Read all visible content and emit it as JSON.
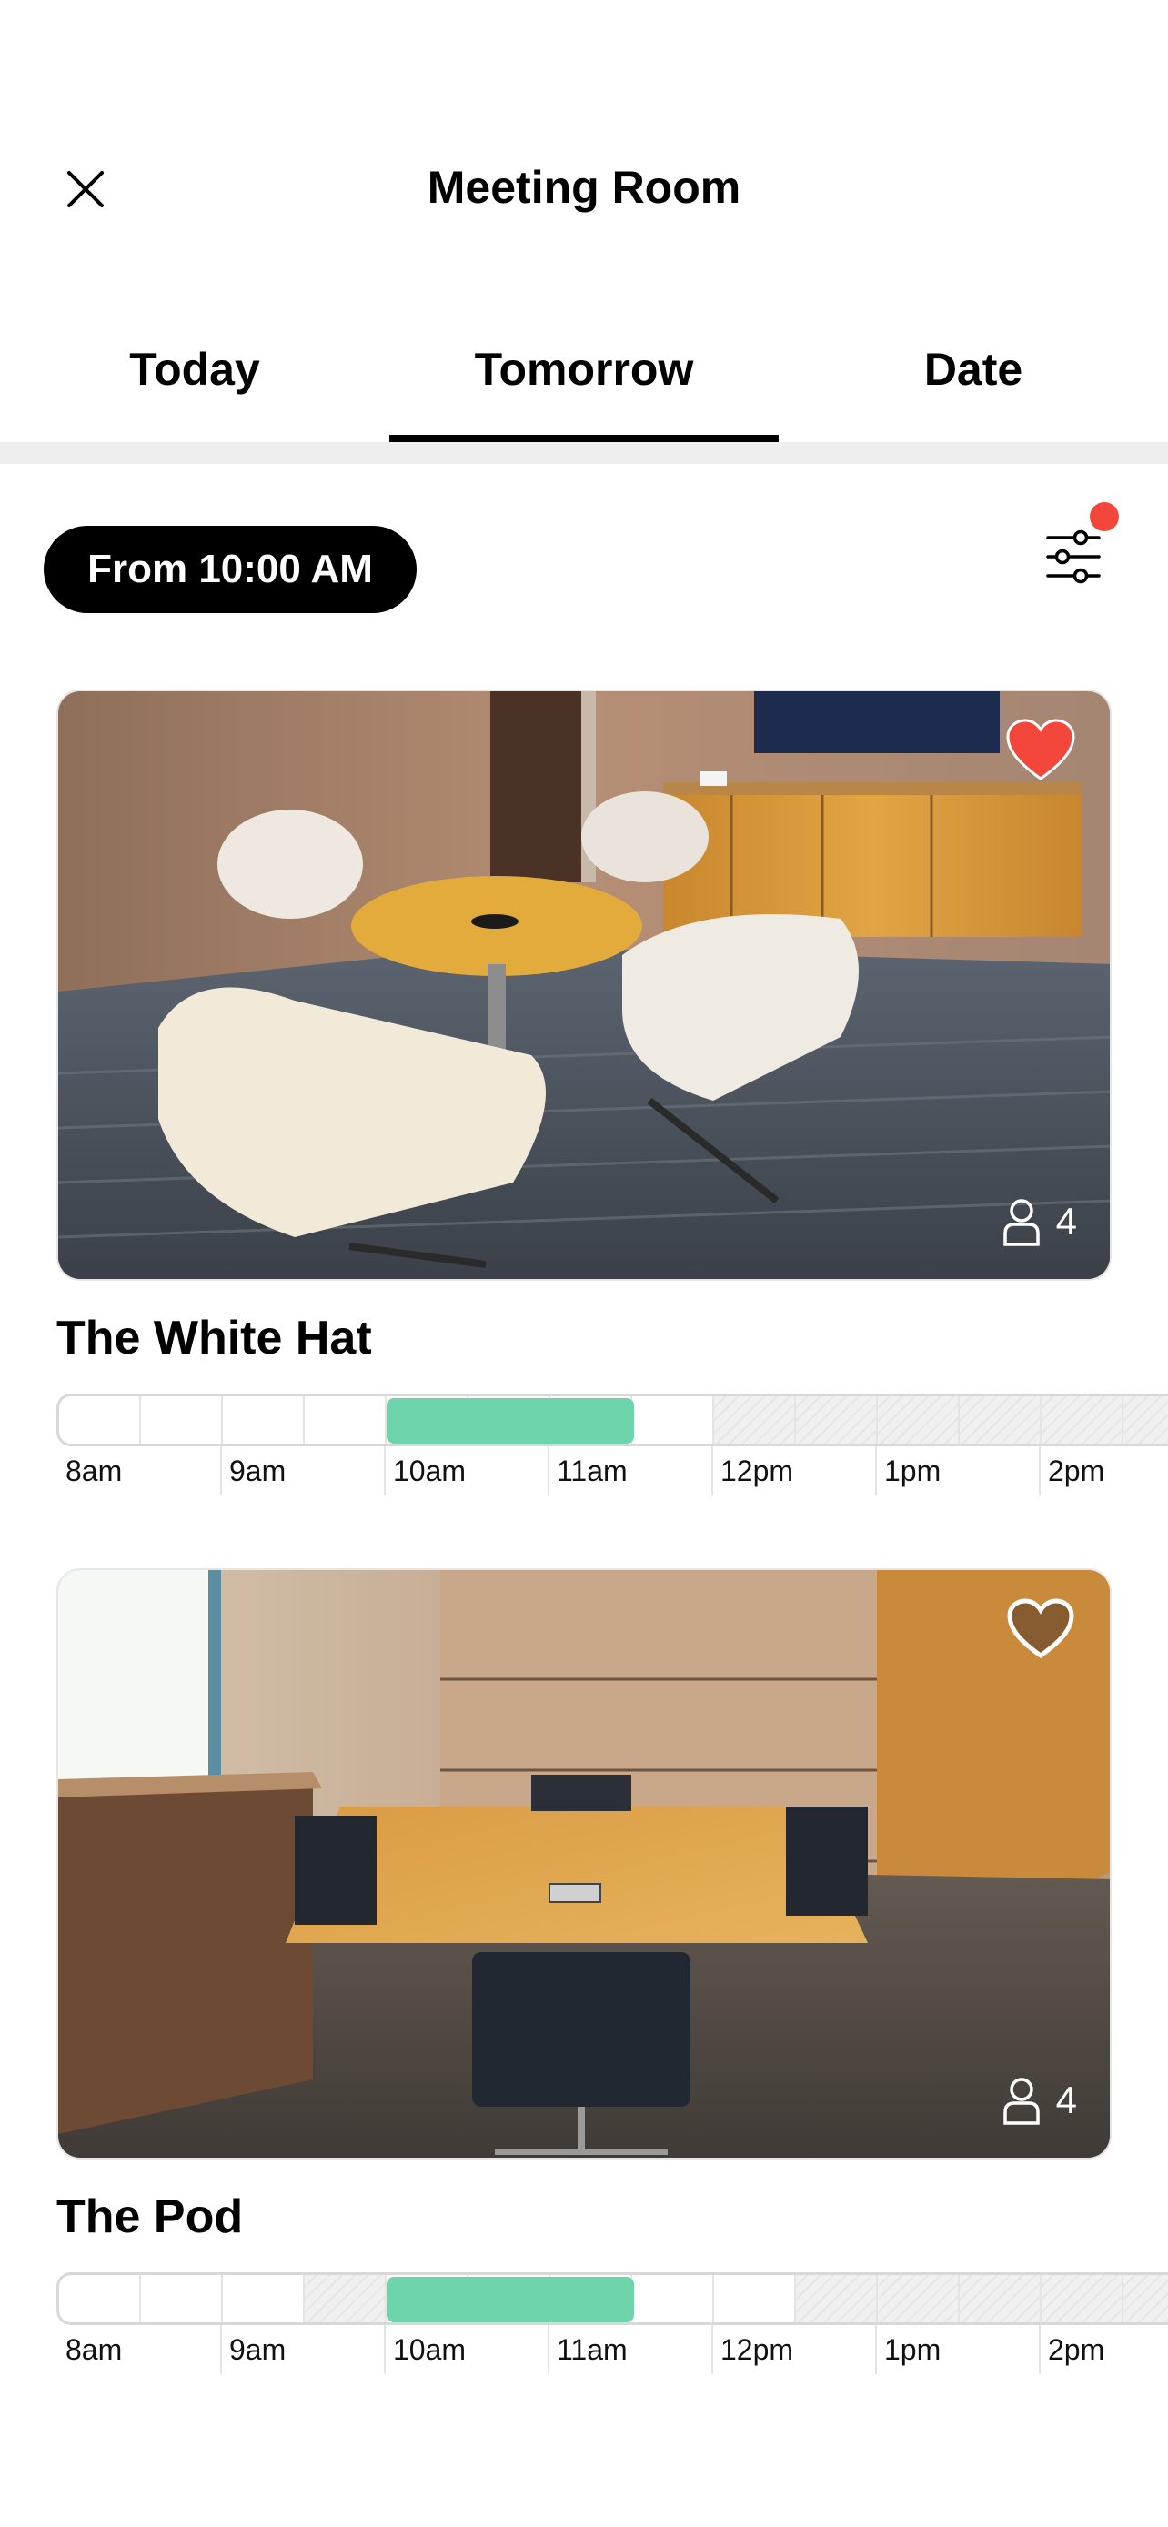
{
  "header": {
    "title": "Meeting Room",
    "close_icon": "close-icon"
  },
  "tabs": [
    {
      "label": "Today",
      "active": false
    },
    {
      "label": "Tomorrow",
      "active": true
    },
    {
      "label": "Date",
      "active": false
    }
  ],
  "filter": {
    "time_chip": "From 10:00 AM",
    "filter_icon": "sliders-icon",
    "has_notification": true
  },
  "colors": {
    "accent_booked": "#6dd4ab",
    "favorite": "#f2473a",
    "notification_dot": "#f2473a"
  },
  "rooms": [
    {
      "name": "The White Hat",
      "capacity": "4",
      "favorite": true,
      "hour_labels": [
        "8am",
        "9am",
        "10am",
        "11am",
        "12pm",
        "1pm",
        "2pm"
      ]
    },
    {
      "name": "The Pod",
      "capacity": "4",
      "favorite": false,
      "hour_labels": [
        "8am",
        "9am",
        "10am",
        "11am",
        "12pm",
        "1pm",
        "2pm"
      ]
    }
  ]
}
